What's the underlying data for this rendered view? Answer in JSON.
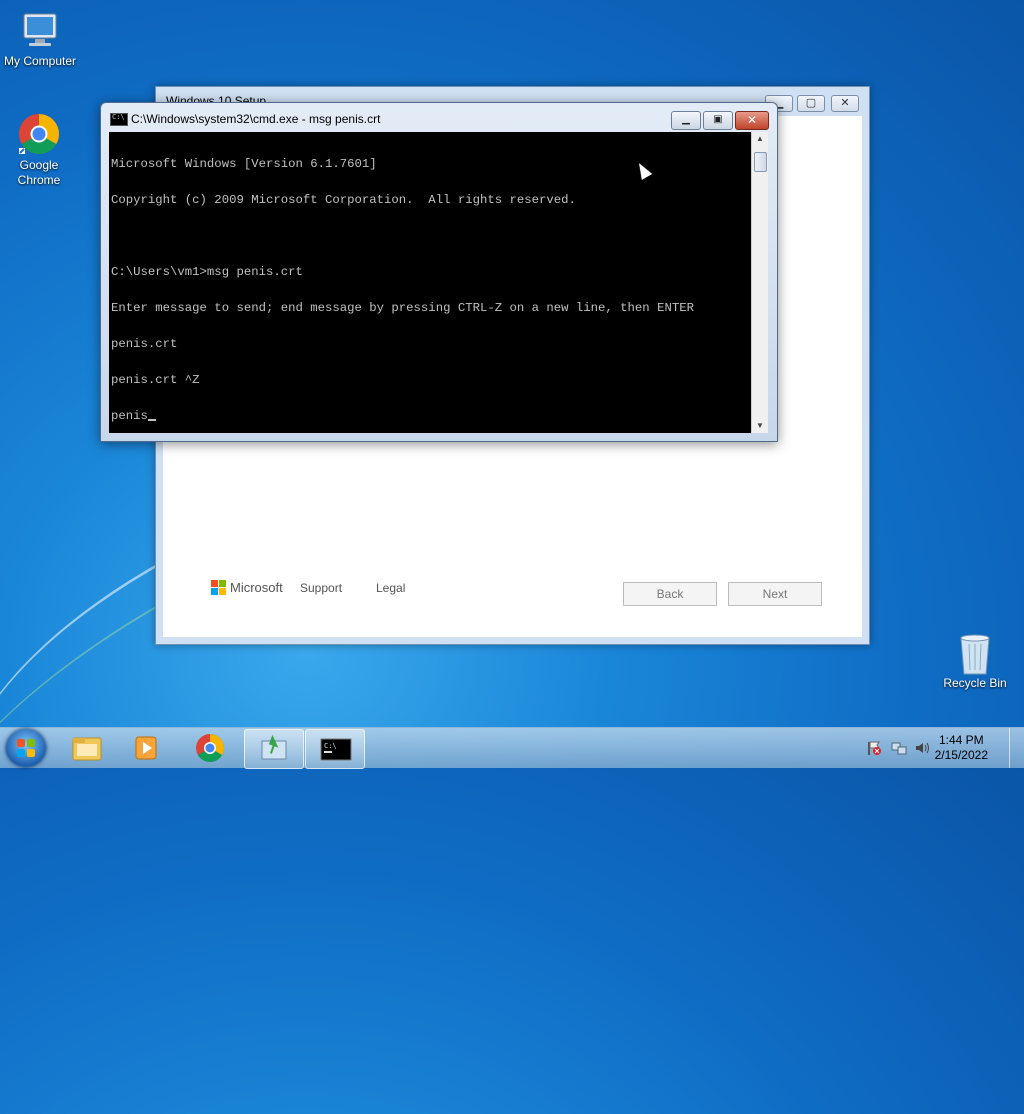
{
  "desktop": {
    "icons": [
      {
        "label": "My Computer"
      },
      {
        "label": "Google\nChrome"
      },
      {
        "label": "Recycle Bin"
      }
    ]
  },
  "setup_window": {
    "title": "Windows 10 Setup",
    "brand": "Microsoft",
    "support_label": "Support",
    "legal_label": "Legal",
    "back_label": "Back",
    "next_label": "Next"
  },
  "cmd_window": {
    "title": "C:\\Windows\\system32\\cmd.exe - msg  penis.crt",
    "lines": [
      "Microsoft Windows [Version 6.1.7601]",
      "Copyright (c) 2009 Microsoft Corporation.  All rights reserved.",
      "",
      "C:\\Users\\vm1>msg penis.crt",
      "Enter message to send; end message by pressing CTRL-Z on a new line, then ENTER",
      "penis.crt",
      "penis.crt ^Z",
      "penis"
    ]
  },
  "taskbar": {
    "items": [
      "windows-explorer",
      "media-player",
      "google-chrome",
      "windows-setup",
      "command-prompt"
    ],
    "active_item": "command-prompt",
    "time": "1:44 PM",
    "date": "2/15/2022"
  },
  "colors": {
    "console_bg": "#000000",
    "console_fg": "#c0c0c0",
    "ms_red": "#f25022",
    "ms_green": "#7fba00",
    "ms_blue": "#00a4ef",
    "ms_yellow": "#ffb900"
  }
}
